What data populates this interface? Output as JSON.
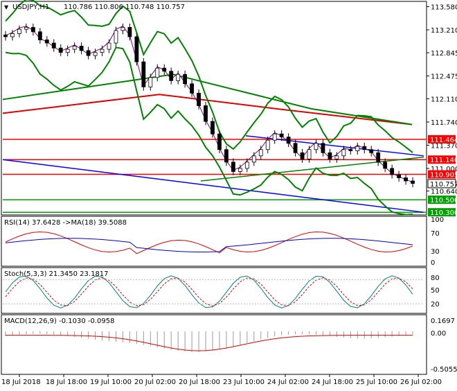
{
  "header": {
    "symbol": "USDJPY,H1",
    "ohlc": "110.786 110.806 110.748 110.757"
  },
  "price_axis": {
    "ticks": [
      "113.580",
      "113.210",
      "112.845",
      "112.475",
      "112.110",
      "111.740",
      "111.370",
      "111.000",
      "110.640"
    ],
    "levels": [
      {
        "label": "111.464",
        "value": 111.464,
        "color": "#ff0000"
      },
      {
        "label": "111.140",
        "value": 111.14,
        "color": "#ff0000"
      },
      {
        "label": "110.905",
        "value": 110.905,
        "color": "#ff0000"
      },
      {
        "label": "110.500",
        "value": 110.5,
        "color": "#00a000"
      },
      {
        "label": "110.300",
        "value": 110.3,
        "color": "#00a000"
      }
    ],
    "current": {
      "label": "110.757",
      "value": 110.757
    }
  },
  "panels": {
    "rsi": {
      "title": "RSI(14) 37.6428 ->MA(18) 39.5088",
      "ticks": [
        "100",
        "70",
        "30",
        "0"
      ]
    },
    "stoch": {
      "title": "Stoch(5,3,3) 21.3450 23.1817",
      "ticks": [
        "80",
        "50",
        "20"
      ]
    },
    "macd": {
      "title": "MACD(12,26,9) -0.1030 -0.0958",
      "ticks": [
        "0.1697",
        "0.00",
        "-0.5055"
      ]
    }
  },
  "time_axis": [
    "18 Jul 2018",
    "18 Jul 18:00",
    "19 Jul 10:00",
    "20 Jul 02:00",
    "20 Jul 18:00",
    "23 Jul 10:00",
    "24 Jul 02:00",
    "24 Jul 18:00",
    "25 Jul 10:00",
    "26 Jul 02:00"
  ],
  "chart_data": {
    "type": "candlestick",
    "title": "USDJPY,H1",
    "ylim": [
      110.28,
      113.62
    ],
    "close": [
      113.1,
      113.15,
      113.22,
      113.25,
      113.18,
      113.05,
      113.0,
      112.92,
      112.85,
      112.9,
      112.95,
      112.88,
      112.8,
      112.85,
      112.9,
      113.0,
      113.2,
      113.25,
      113.1,
      112.7,
      112.3,
      112.45,
      112.6,
      112.55,
      112.4,
      112.5,
      112.35,
      112.2,
      112.0,
      111.75,
      111.55,
      111.3,
      111.1,
      110.95,
      111.0,
      111.1,
      111.2,
      111.3,
      111.45,
      111.55,
      111.5,
      111.4,
      111.25,
      111.15,
      111.3,
      111.4,
      111.25,
      111.15,
      111.2,
      111.3,
      111.28,
      111.35,
      111.3,
      111.25,
      111.1,
      111.0,
      110.9,
      110.85,
      110.8,
      110.76
    ],
    "colors": {
      "candle": "#000000",
      "red_line": "#dd0000",
      "green_line": "#008000",
      "blue_line": "#0000ff",
      "ma_purple": "#800080"
    }
  }
}
